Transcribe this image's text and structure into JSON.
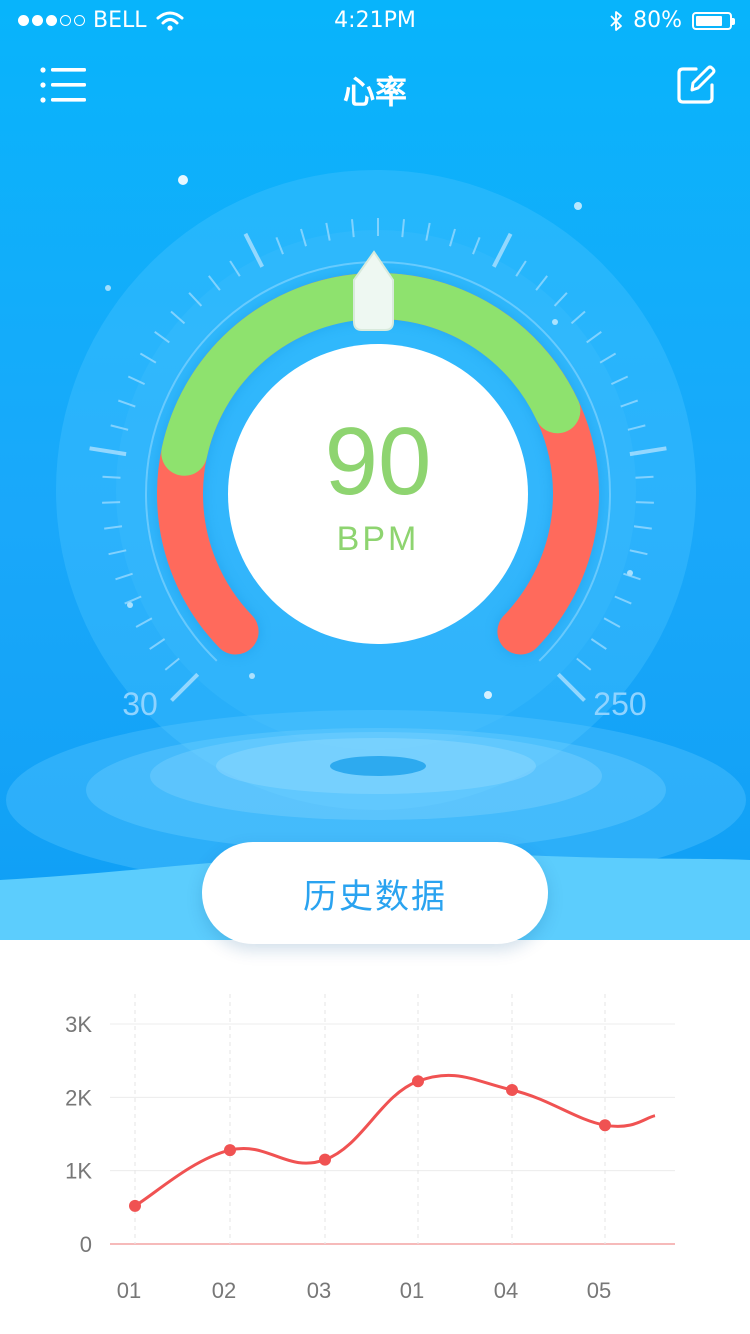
{
  "status_bar": {
    "carrier": "BELL",
    "time": "4:21PM",
    "battery_percent": "80%",
    "battery_level": 0.8,
    "signal_bars": 3,
    "signal_total": 5,
    "icons": [
      "wifi-icon",
      "bluetooth-icon",
      "battery-icon"
    ]
  },
  "header": {
    "title": "心率",
    "menu_icon": "menu-list-icon",
    "edit_icon": "edit-icon"
  },
  "gauge": {
    "value": "90",
    "unit": "BPM",
    "min_label": "30",
    "max_label": "250",
    "min": 30,
    "max": 250,
    "current": 90,
    "colors": {
      "normal": "#8ee26e",
      "warning": "#ff6a5c",
      "value_text": "#8ed470"
    }
  },
  "history_button": {
    "label": "历史数据"
  },
  "chart_data": {
    "type": "line",
    "categories": [
      "01",
      "02",
      "03",
      "01",
      "04",
      "05"
    ],
    "series": [
      {
        "values": [
          520,
          1280,
          1150,
          2220,
          2100,
          1620
        ]
      }
    ],
    "y_ticks": [
      "0",
      "1K",
      "2K",
      "3K"
    ],
    "ylim": [
      0,
      3000
    ],
    "grid": true,
    "line_color": "#f05252"
  }
}
